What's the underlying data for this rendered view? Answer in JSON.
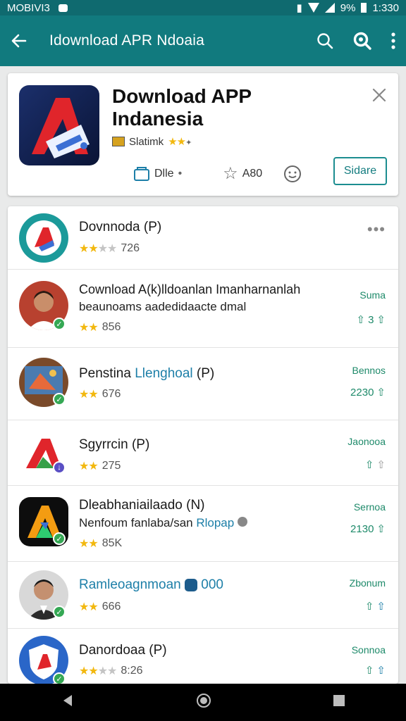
{
  "status_bar": {
    "left_text": "MOBIVI3",
    "battery_text": "9%",
    "time": "1:330"
  },
  "app_bar": {
    "title": "Idownload APR Ndoaia"
  },
  "hero": {
    "title": "Download APP Indanesia",
    "subtitle": "Slatimk",
    "actions": {
      "file_label": "Dlle",
      "rating_label": "A80",
      "side_button": "Sidare"
    }
  },
  "list": [
    {
      "title": "Dovnnoda (P)",
      "rating_text": "726",
      "stars": 2
    },
    {
      "title": "Cownload A(k)lldoanlan Imanharnanlah",
      "subtitle": "beaunoams aadedidaacte dmal",
      "rating_text": "856",
      "label": "Suma",
      "count": "3",
      "stars": 2
    },
    {
      "title": "Penstina ",
      "title_accent": "Llenghoal",
      "title_suffix": " (P)",
      "rating_text": "676",
      "label": "Bennos",
      "count": "2230",
      "stars": 2
    },
    {
      "title": "Sgyrrcin (P)",
      "rating_text": "275",
      "label": "Jaonooa",
      "stars": 2
    },
    {
      "title": "Dleabhaniailaado (N)",
      "subtitle": "Nenfoum fanlaba/san ",
      "subtitle_accent": "Rlopap",
      "rating_text": "85K",
      "label": "Sernoa",
      "count": "2130",
      "stars": 2
    },
    {
      "title": "Ramleoagnmoan",
      "title_suffix": "000",
      "rating_text": "666",
      "label": "Zbonum",
      "stars": 2
    },
    {
      "title": "Danordoaa (P)",
      "rating_text": "8:26",
      "label": "Sonnoa",
      "stars": 2
    }
  ],
  "colors": {
    "app_bar": "#117a7e",
    "accent": "#1c8d90",
    "star": "#f2b80f",
    "badge": "#35a854"
  }
}
